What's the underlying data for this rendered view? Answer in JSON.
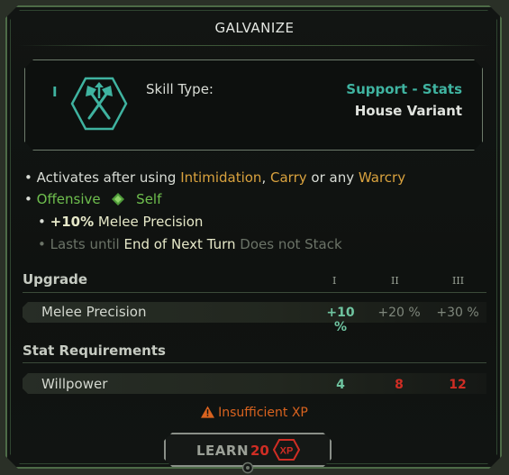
{
  "title": "GALVANIZE",
  "card": {
    "tier": "I",
    "icon": "crossed-axes-icon",
    "skill_type_label": "Skill Type:",
    "skill_type_value": "Support - Stats",
    "variant": "House Variant"
  },
  "description": {
    "line1_prefix": "• Activates after using",
    "line1_item1": "Intimidation",
    "line1_sep1": ",",
    "line1_item2": "Carry",
    "line1_sep2": "or any",
    "line1_item3": "Warcry",
    "line2_bullet": "•",
    "line2_target1": "Offensive",
    "line2_icon": "green-diamond-icon",
    "line2_target2": "Self",
    "line3_bullet": "•",
    "line3_value": "+10%",
    "line3_stat": "Melee Precision",
    "line4_bullet": "•",
    "line4_prefix": "Lasts until",
    "line4_duration": "End of Next Turn",
    "line4_suffix": "Does not Stack"
  },
  "upgrade": {
    "heading": "Upgrade",
    "tiers": [
      "I",
      "II",
      "III"
    ],
    "row_label": "Melee Precision",
    "values": [
      "+10 %",
      "+20 %",
      "+30 %"
    ]
  },
  "requirements": {
    "heading": "Stat Requirements",
    "row_label": "Willpower",
    "values": [
      "4",
      "8",
      "12"
    ]
  },
  "warning": "Insufficient XP",
  "learn": {
    "label": "LEARN",
    "cost": "20",
    "currency": "XP"
  },
  "colors": {
    "accent_teal": "#3fb3a0",
    "gold": "#d9a23e",
    "green": "#6fbf4e",
    "red": "#cf2d24",
    "warning_orange": "#d9631f"
  }
}
